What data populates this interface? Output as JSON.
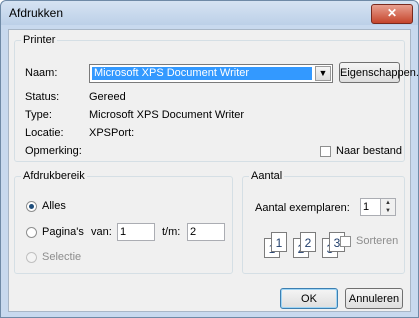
{
  "window": {
    "title": "Afdrukken",
    "close_glyph": "✕"
  },
  "printer": {
    "group_label": "Printer",
    "name_label": "Naam:",
    "name_value": "Microsoft XPS Document Writer",
    "properties_button": "Eigenschappen...",
    "status_label": "Status:",
    "status_value": "Gereed",
    "type_label": "Type:",
    "type_value": "Microsoft XPS Document Writer",
    "location_label": "Locatie:",
    "location_value": "XPSPort:",
    "comment_label": "Opmerking:",
    "print_to_file_label": "Naar bestand",
    "print_to_file_checked": false
  },
  "range": {
    "group_label": "Afdrukbereik",
    "all_label": "Alles",
    "all_selected": true,
    "pages_label": "Pagina's",
    "from_label": "van:",
    "from_value": "1",
    "to_label": "t/m:",
    "to_value": "2",
    "selection_label": "Selectie"
  },
  "copies": {
    "group_label": "Aantal",
    "copies_label": "Aantal exemplaren:",
    "copies_value": "1",
    "collate_label": "Sorteren",
    "collate_checked": false,
    "collate_pages": [
      "1",
      "1",
      "2",
      "2",
      "3",
      "3"
    ]
  },
  "footer": {
    "ok_button": "OK",
    "cancel_button": "Annuleren"
  }
}
